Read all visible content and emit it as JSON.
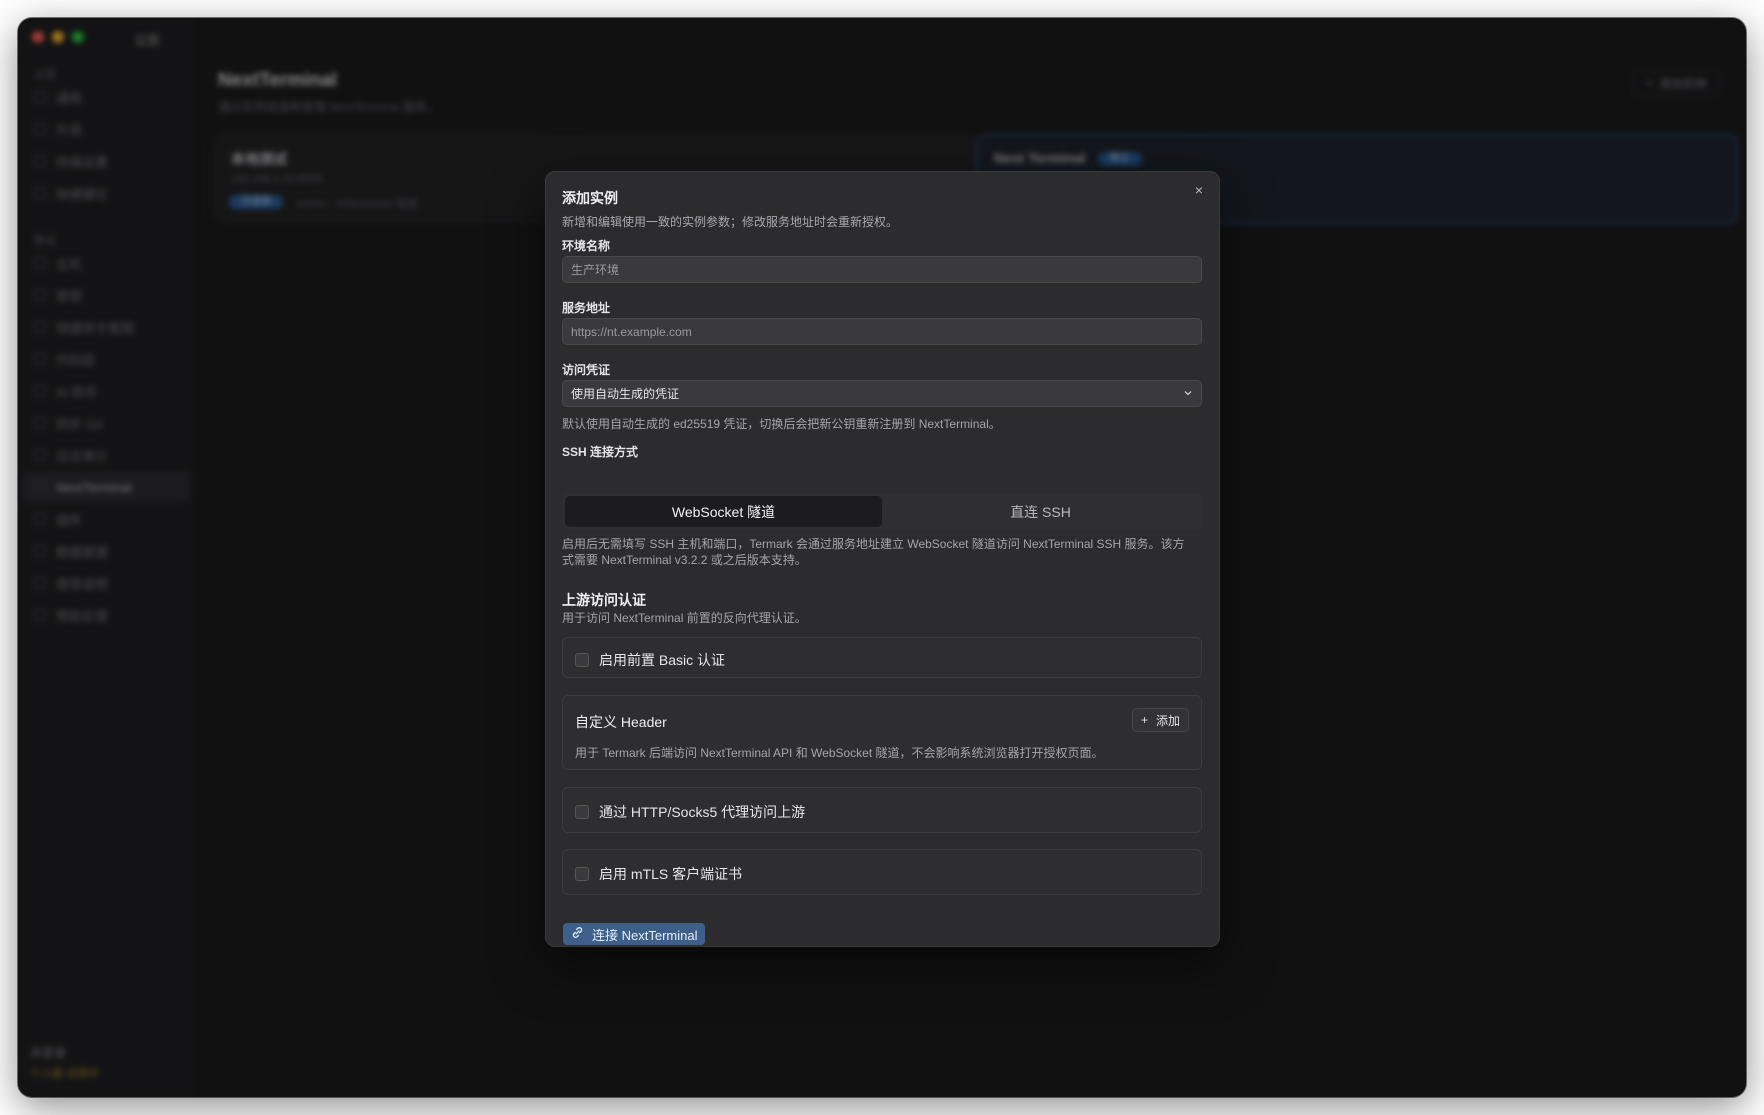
{
  "window": {
    "title": "设置"
  },
  "sidebar": {
    "section_1": "设置",
    "items_1": [
      "通用",
      "外观",
      "终端设置",
      "快捷键位"
    ],
    "section_2": "集成",
    "items_2": [
      "主机",
      "密钥",
      "快捷命令管理",
      "代码段",
      "AI 助手",
      "同步 Git",
      "日志审计",
      "NextTerminal",
      "插件",
      "数据管理",
      "使用说明",
      "帮助反馈"
    ],
    "active_item": "NextTerminal",
    "footer_name": "未登录",
    "footer_sub": "个人版 试用中"
  },
  "page": {
    "title": "NextTerminal",
    "subtitle": "通过实例连接和管理 NextTerminal 服务。",
    "add_button": "添加实例",
    "cards": [
      {
        "name": "本地测试",
        "sub": "192.168.1.10:8088",
        "badge": "已连接",
        "meta": "admin · WebSocket 隧道"
      },
      {
        "name": "Next Terminal",
        "sub": "",
        "badge": "默认",
        "meta": ""
      }
    ]
  },
  "modal": {
    "title": "添加实例",
    "description": "新增和编辑使用一致的实例参数；修改服务地址时会重新授权。",
    "close_icon": "×",
    "env_name": {
      "label": "环境名称",
      "placeholder": "生产环境"
    },
    "server_url": {
      "label": "服务地址",
      "placeholder": "https://nt.example.com"
    },
    "credential": {
      "label": "访问凭证",
      "selected": "使用自动生成的凭证",
      "hint": "默认使用自动生成的 ed25519 凭证，切换后会把新公钥重新注册到 NextTerminal。"
    },
    "ssh_mode": {
      "label": "SSH 连接方式",
      "options": [
        "WebSocket 隧道",
        "直连 SSH"
      ],
      "selected": "WebSocket 隧道",
      "hint_line1": "启用后无需填写 SSH 主机和端口，Termark 会通过服务地址建立 WebSocket 隧道访问 NextTerminal SSH 服务。该方",
      "hint_line2": "式需要 NextTerminal v3.2.2 或之后版本支持。"
    },
    "upstream": {
      "title": "上游访问认证",
      "subtitle": "用于访问 NextTerminal 前置的反向代理认证。",
      "basic_auth": {
        "label": "启用前置 Basic 认证",
        "checked": false
      },
      "custom_header": {
        "title": "自定义 Header",
        "add_label": "添加",
        "hint": "用于 Termark 后端访问 NextTerminal API 和 WebSocket 隧道，不会影响系统浏览器打开授权页面。"
      },
      "proxy": {
        "label": "通过 HTTP/Socks5 代理访问上游",
        "checked": false
      },
      "mtls": {
        "label": "启用 mTLS 客户端证书",
        "checked": false
      }
    },
    "connect_button": "连接 NextTerminal",
    "accent_color": "#3e5f8a"
  }
}
